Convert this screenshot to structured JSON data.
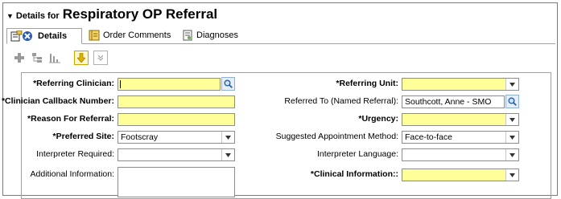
{
  "header": {
    "prefix": "Details for",
    "title": "Respiratory OP Referral"
  },
  "tabs": [
    {
      "label": "Details"
    },
    {
      "label": "Order Comments"
    },
    {
      "label": "Diagnoses"
    }
  ],
  "form": {
    "left": [
      {
        "label": "*Referring Clinician:",
        "value": ""
      },
      {
        "label": "*Clinician Callback Number:",
        "value": ""
      },
      {
        "label": "*Reason For Referral:",
        "value": ""
      },
      {
        "label": "*Preferred Site:",
        "value": "Footscray"
      },
      {
        "label": "Interpreter Required:",
        "value": ""
      },
      {
        "label": "Additional Information:",
        "value": ""
      }
    ],
    "right": [
      {
        "label": "*Referring Unit:",
        "value": ""
      },
      {
        "label": "Referred To (Named Referral):",
        "value": "Southcott, Anne  - SMO"
      },
      {
        "label": "*Urgency:",
        "value": ""
      },
      {
        "label": "Suggested Appointment Method:",
        "value": "Face-to-face"
      },
      {
        "label": "Interpreter Language:",
        "value": ""
      },
      {
        "label": "*Clinical Information::",
        "value": ""
      }
    ]
  },
  "colors": {
    "required_field": "#ffff99",
    "border": "#8c8c8c"
  }
}
